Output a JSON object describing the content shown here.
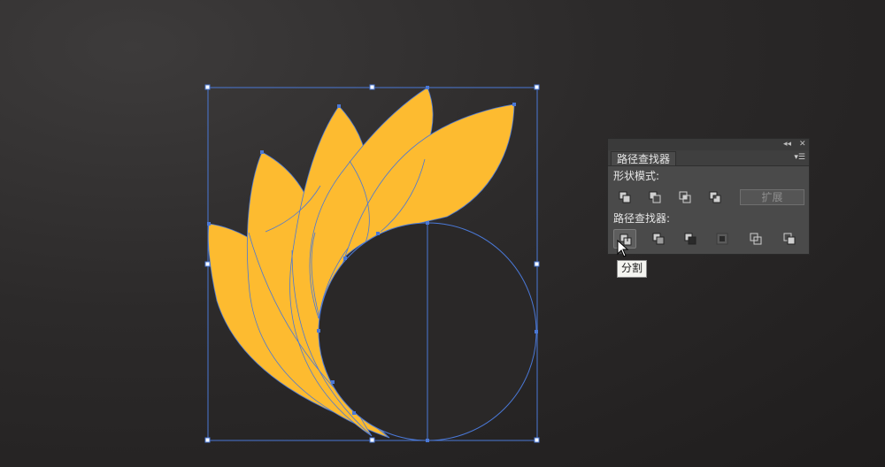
{
  "colors": {
    "petal_fill": "#fdbb30",
    "selection": "#4a78d6",
    "panel_bg": "#4a4a4a"
  },
  "panel": {
    "title": "路径查找器",
    "collapse_icon": "double-chevron-left-icon",
    "close_icon": "close-icon",
    "menu_icon": "panel-menu-icon",
    "shape_modes": {
      "label": "形状模式:",
      "buttons": [
        "unite-icon",
        "minus-front-icon",
        "intersect-icon",
        "exclude-icon"
      ],
      "expand_label": "扩展"
    },
    "pathfinders": {
      "label": "路径查找器:",
      "buttons": [
        "divide-icon",
        "trim-icon",
        "merge-icon",
        "crop-icon",
        "outline-icon",
        "minus-back-icon"
      ],
      "active": "divide-icon"
    }
  },
  "tooltip": {
    "text": "分割"
  }
}
